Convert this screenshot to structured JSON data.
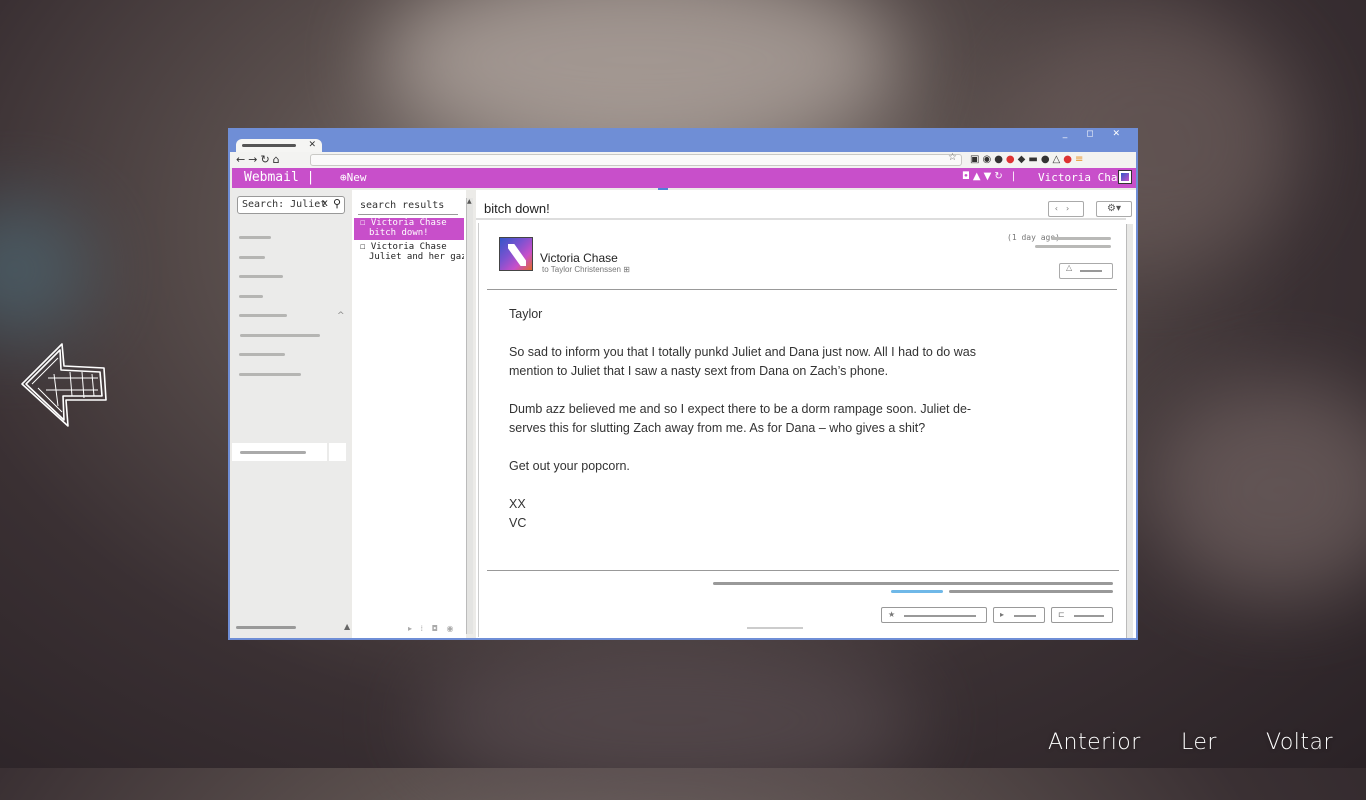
{
  "browser": {
    "window_controls": "_ ◻ ✕",
    "tab_close": "✕"
  },
  "webmail": {
    "brand": "Webmail  |",
    "new_button": "⊕New",
    "user": "Victoria Chase",
    "accent_color": "#c84fca",
    "frame_color": "#6f8ed6"
  },
  "sidebar": {
    "search_value": "Search: Juliet",
    "search_clear": "x"
  },
  "results": {
    "header": "search results",
    "items": [
      {
        "from": "☐ Victoria Chase",
        "subject": "bitch down!",
        "selected": true
      },
      {
        "from": "☐ Victoria Chase",
        "subject": "Juliet and her gazette...",
        "selected": false
      }
    ]
  },
  "message": {
    "subject": "bitch down!",
    "sender": "Victoria Chase",
    "recipient": "to Taylor Christenssen ⊞",
    "timestamp": "(1 day ago)",
    "body": {
      "greeting": "Taylor",
      "p1_l1": "So sad to inform you that I totally punkd Juliet and Dana just now. All I had to do was",
      "p1_l2": "mention to Juliet that I saw a nasty sext from Dana on Zach’s phone.",
      "p2_l1": "Dumb azz believed me and so I expect there to be a dorm rampage soon. Juliet de-",
      "p2_l2": "serves this for slutting Zach away from me. As for Dana – who gives a shit?",
      "p3": "Get out your popcorn.",
      "sign1": "XX",
      "sign2": "VC"
    }
  },
  "game_menu": {
    "previous": "Anterior",
    "read": "Ler",
    "back": "Voltar"
  }
}
